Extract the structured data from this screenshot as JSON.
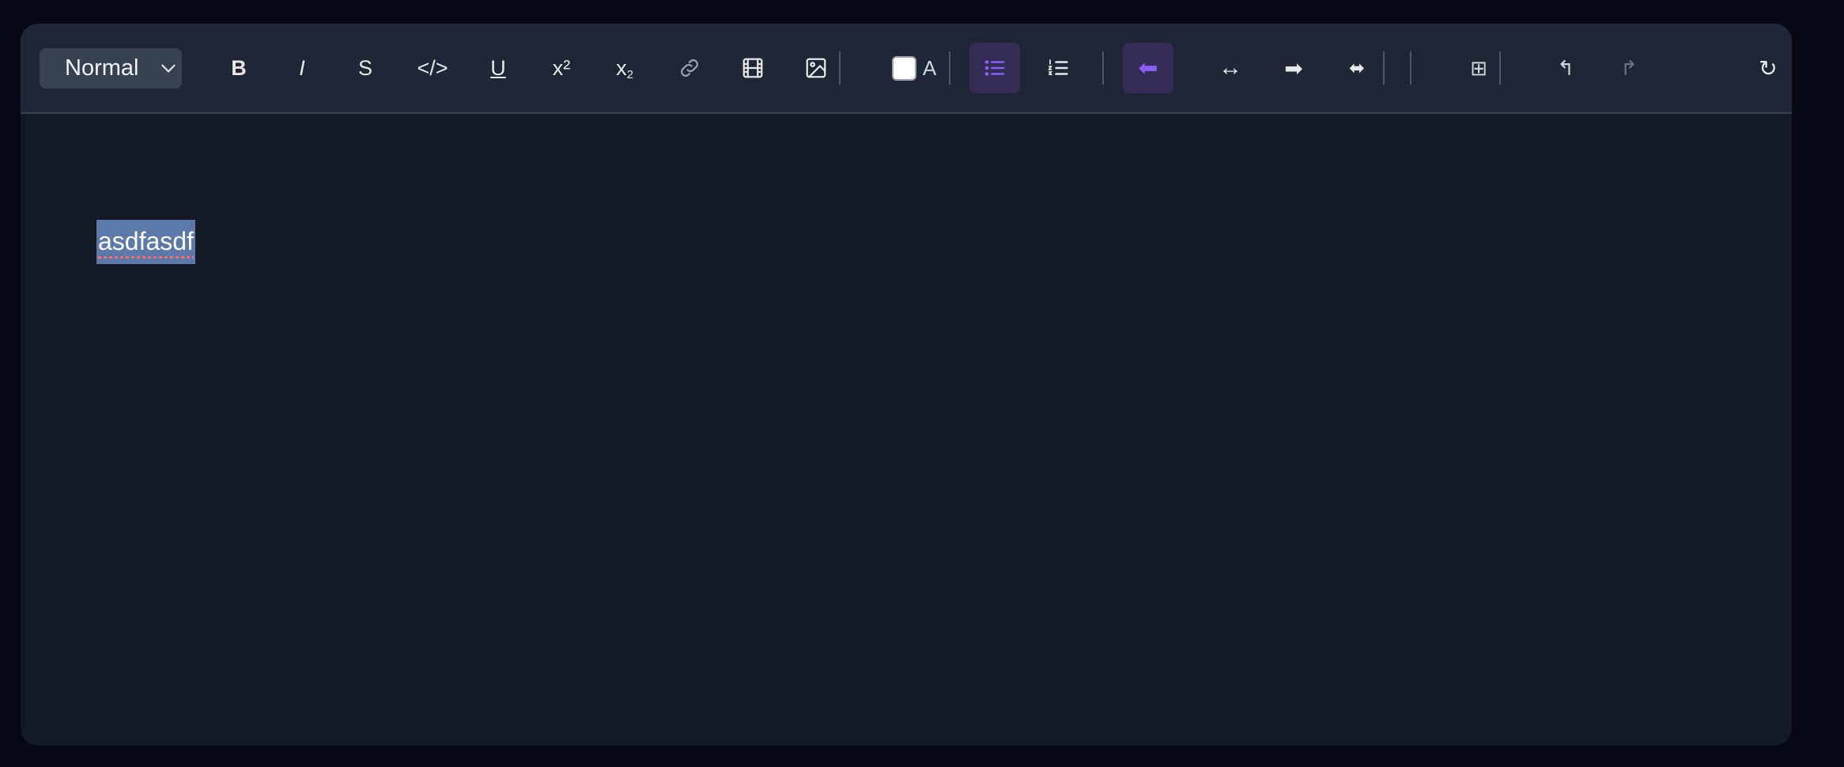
{
  "toolbar": {
    "block_format": "Normal",
    "bold_label": "B",
    "italic_label": "I",
    "strike_label": "S",
    "code_label": "</>",
    "underline_label": "U",
    "superscript_label": "x²",
    "subscript_label": "x",
    "subscript_sub": "2",
    "text_color_label": "A",
    "align_left_glyph": "⬅",
    "align_center_glyph": "↔",
    "align_right_glyph": "➡",
    "justify_glyph": "⬌",
    "table_glyph": "⊞",
    "undo_glyph": "↰",
    "redo_glyph": "↱",
    "refresh_glyph": "↻",
    "icons": [
      "chevron-down-icon",
      "link-icon",
      "video-icon",
      "image-icon",
      "bullet-list-icon",
      "numbered-list-icon"
    ],
    "active": [
      "bullet-list",
      "align-left"
    ]
  },
  "content": {
    "text": "asdfasdf"
  },
  "colors": {
    "page_bg": "#050914",
    "editor_bg": "#131927",
    "toolbar_bg": "#1f2737",
    "accent": "#8b5cf6",
    "active_bg": "#352c55",
    "selection": "#5d79a8"
  }
}
